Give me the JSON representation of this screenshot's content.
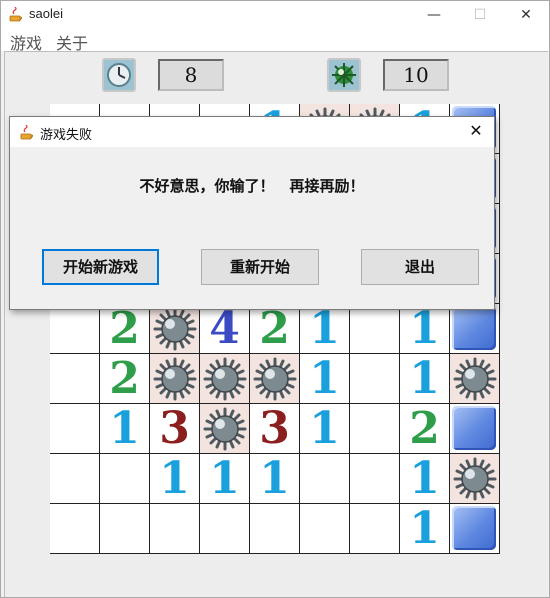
{
  "window": {
    "title": "saolei",
    "minimize": "—",
    "maximize": "☐",
    "close": "✕"
  },
  "menu": [
    {
      "label": "游戏"
    },
    {
      "label": "关于"
    }
  ],
  "toolbar": {
    "time_value": "8",
    "mines_value": "10",
    "clock_icon": "clock-icon",
    "mine_icon": "mine-icon"
  },
  "board": {
    "rows": [
      [
        "",
        "",
        "",
        "",
        "1",
        "M",
        "M",
        "1",
        "C"
      ],
      [
        "",
        "",
        "",
        "",
        "",
        "",
        "",
        "",
        "C"
      ],
      [
        "",
        "",
        "",
        "",
        "",
        "",
        "",
        "",
        "C"
      ],
      [
        "",
        "",
        "",
        "",
        "",
        "",
        "",
        "",
        "C"
      ],
      [
        "",
        "2",
        "M",
        "4",
        "2",
        "1",
        "",
        "1",
        "C"
      ],
      [
        "",
        "2",
        "M",
        "M",
        "M",
        "1",
        "",
        "1",
        "M"
      ],
      [
        "",
        "1",
        "3",
        "M",
        "3",
        "1",
        "",
        "2",
        "C"
      ],
      [
        "",
        "",
        "1",
        "1",
        "1",
        "",
        "",
        "1",
        "M"
      ],
      [
        "",
        "",
        "",
        "",
        "",
        "",
        "",
        "1",
        "C"
      ]
    ]
  },
  "dialog": {
    "title": "游戏失败",
    "message": "不好意思，你输了！　再接再励！",
    "close": "✕",
    "buttons": [
      {
        "label": "开始新游戏"
      },
      {
        "label": "重新开始"
      },
      {
        "label": "退出"
      }
    ]
  }
}
